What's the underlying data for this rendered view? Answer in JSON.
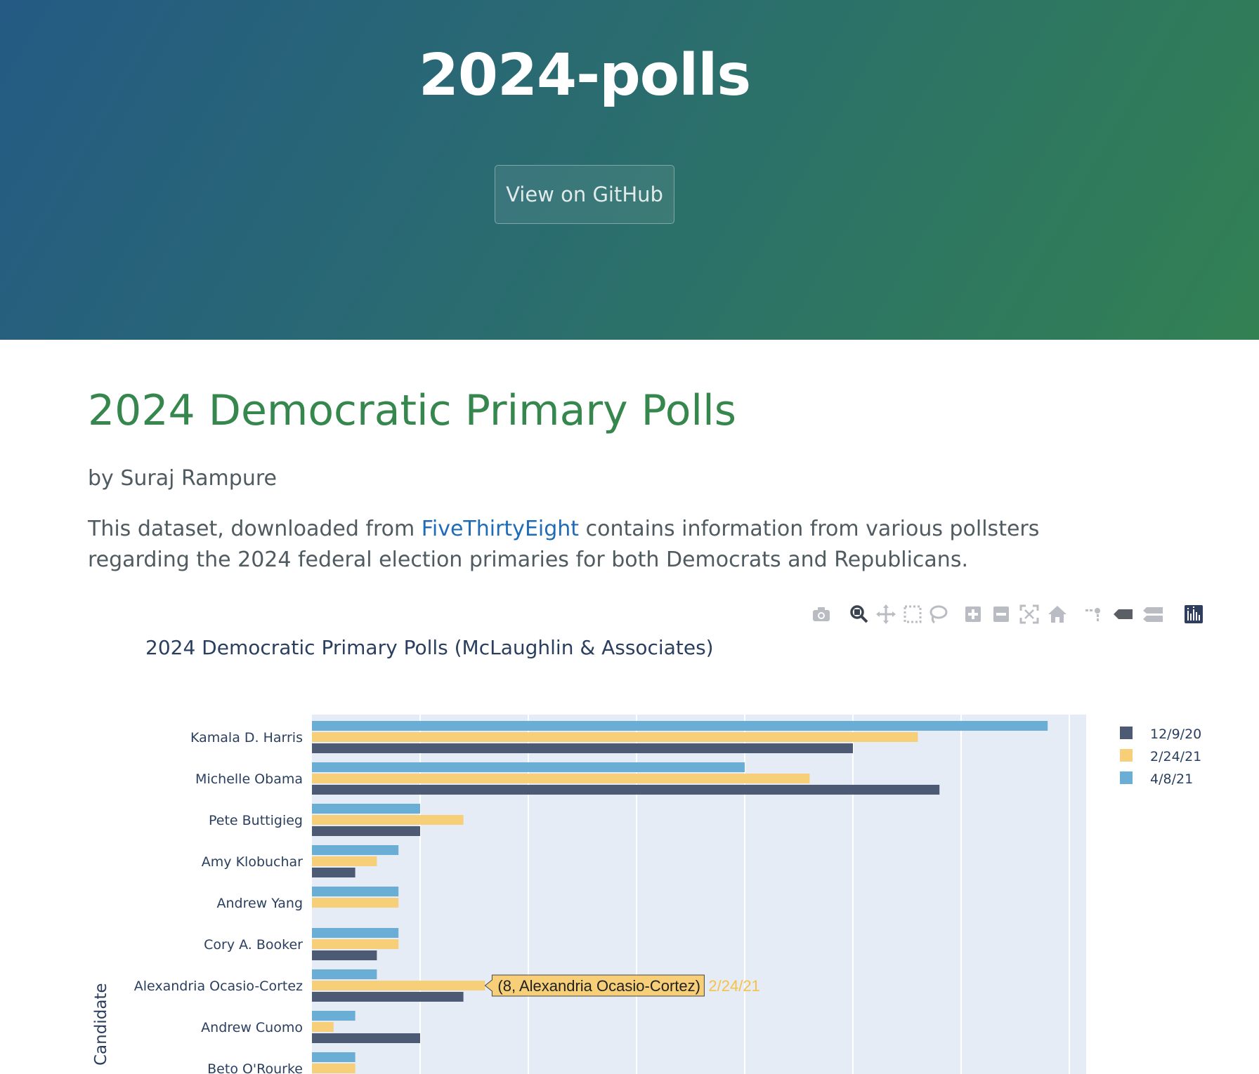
{
  "header": {
    "title": "2024-polls",
    "github_button": "View on GitHub"
  },
  "main": {
    "heading": "2024 Democratic Primary Polls",
    "byline": "by Suraj Rampure",
    "intro_before": "This dataset, downloaded from ",
    "intro_link": "FiveThirtyEight",
    "intro_after": " contains information from various pollsters regarding the 2024 federal election primaries for both Democrats and Republicans."
  },
  "toolbar": {
    "icons": [
      "camera-icon",
      "zoom-icon",
      "pan-icon",
      "box-select-icon",
      "lasso-select-icon",
      "zoom-in-icon",
      "zoom-out-icon",
      "autoscale-icon",
      "reset-axes-icon",
      "spike-lines-icon",
      "hover-closest-icon",
      "hover-compare-icon",
      "plotly-logo-icon"
    ]
  },
  "chart_data": {
    "type": "bar",
    "orientation": "horizontal",
    "title": "2024 Democratic Primary Polls (McLaughlin & Associates)",
    "ylabel": "Candidate",
    "xlim": [
      0,
      36
    ],
    "grid": true,
    "legend_position": "top-right",
    "categories": [
      "Kamala D. Harris",
      "Michelle Obama",
      "Pete Buttigieg",
      "Amy Klobuchar",
      "Andrew Yang",
      "Cory A. Booker",
      "Alexandria Ocasio-Cortez",
      "Andrew Cuomo",
      "Beto O'Rourke"
    ],
    "series": [
      {
        "name": "12/9/20",
        "color": "#4d5a74",
        "values": [
          25,
          29,
          5,
          2,
          0,
          3,
          7,
          5,
          null
        ]
      },
      {
        "name": "2/24/21",
        "color": "#f6cf78",
        "values": [
          28,
          23,
          7,
          3,
          4,
          4,
          8,
          1,
          2
        ]
      },
      {
        "name": "4/8/21",
        "color": "#6aaed6",
        "values": [
          34,
          20,
          5,
          4,
          4,
          4,
          3,
          2,
          2
        ]
      }
    ],
    "hover": {
      "text": "(8, Alexandria Ocasio-Cortez)",
      "series": "2/24/21",
      "category_index": 6
    }
  }
}
